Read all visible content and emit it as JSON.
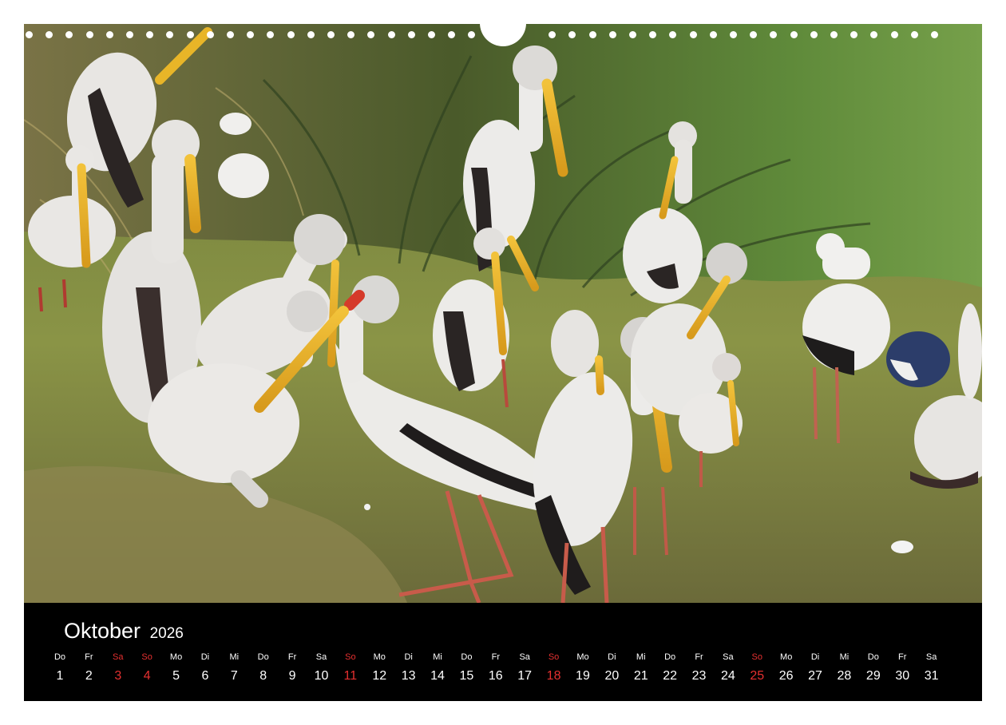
{
  "calendar": {
    "month": "Oktober",
    "year": "2026",
    "sunday_color": "#e53030",
    "days": [
      {
        "weekday": "Do",
        "date": "1",
        "sunday": false
      },
      {
        "weekday": "Fr",
        "date": "2",
        "sunday": false
      },
      {
        "weekday": "Sa",
        "date": "3",
        "sunday": true
      },
      {
        "weekday": "So",
        "date": "4",
        "sunday": true
      },
      {
        "weekday": "Mo",
        "date": "5",
        "sunday": false
      },
      {
        "weekday": "Di",
        "date": "6",
        "sunday": false
      },
      {
        "weekday": "Mi",
        "date": "7",
        "sunday": false
      },
      {
        "weekday": "Do",
        "date": "8",
        "sunday": false
      },
      {
        "weekday": "Fr",
        "date": "9",
        "sunday": false
      },
      {
        "weekday": "Sa",
        "date": "10",
        "sunday": false
      },
      {
        "weekday": "So",
        "date": "11",
        "sunday": true
      },
      {
        "weekday": "Mo",
        "date": "12",
        "sunday": false
      },
      {
        "weekday": "Di",
        "date": "13",
        "sunday": false
      },
      {
        "weekday": "Mi",
        "date": "14",
        "sunday": false
      },
      {
        "weekday": "Do",
        "date": "15",
        "sunday": false
      },
      {
        "weekday": "Fr",
        "date": "16",
        "sunday": false
      },
      {
        "weekday": "Sa",
        "date": "17",
        "sunday": false
      },
      {
        "weekday": "So",
        "date": "18",
        "sunday": true
      },
      {
        "weekday": "Mo",
        "date": "19",
        "sunday": false
      },
      {
        "weekday": "Di",
        "date": "20",
        "sunday": false
      },
      {
        "weekday": "Mi",
        "date": "21",
        "sunday": false
      },
      {
        "weekday": "Do",
        "date": "22",
        "sunday": false
      },
      {
        "weekday": "Fr",
        "date": "23",
        "sunday": false
      },
      {
        "weekday": "Sa",
        "date": "24",
        "sunday": false
      },
      {
        "weekday": "So",
        "date": "25",
        "sunday": true
      },
      {
        "weekday": "Mo",
        "date": "26",
        "sunday": false
      },
      {
        "weekday": "Di",
        "date": "27",
        "sunday": false
      },
      {
        "weekday": "Mi",
        "date": "28",
        "sunday": false
      },
      {
        "weekday": "Do",
        "date": "29",
        "sunday": false
      },
      {
        "weekday": "Fr",
        "date": "30",
        "sunday": false
      },
      {
        "weekday": "Sa",
        "date": "31",
        "sunday": false
      }
    ]
  }
}
